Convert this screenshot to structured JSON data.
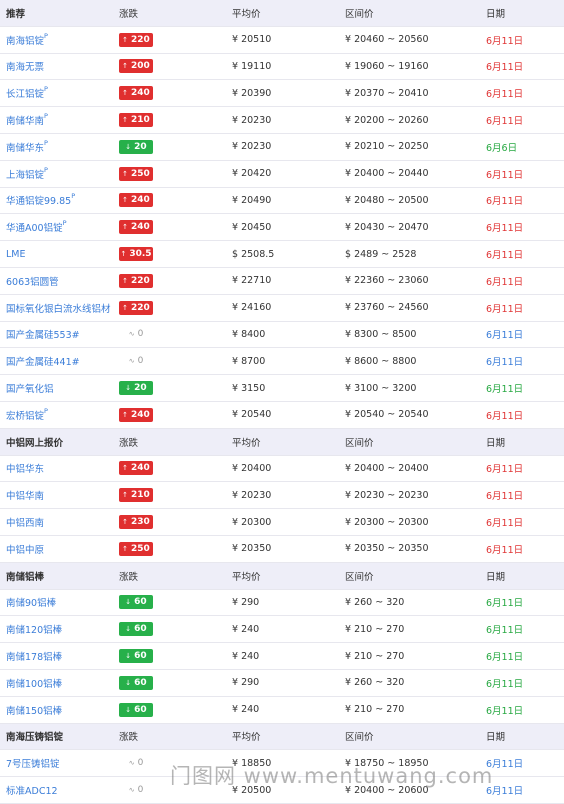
{
  "sections": [
    {
      "header": {
        "name": "推荐",
        "change": "涨跌",
        "avg": "平均价",
        "range": "区间价",
        "date": "日期"
      },
      "rows": [
        {
          "name": "南海铝锭",
          "sup": "P",
          "dir": "up",
          "change": "220",
          "avg": "¥ 20510",
          "range": "¥ 20460 ~ 20560",
          "date": "6月11日",
          "dateColor": "red"
        },
        {
          "name": "南海无票",
          "sup": "",
          "dir": "up",
          "change": "200",
          "avg": "¥ 19110",
          "range": "¥ 19060 ~ 19160",
          "date": "6月11日",
          "dateColor": "red"
        },
        {
          "name": "长江铝锭",
          "sup": "P",
          "dir": "up",
          "change": "240",
          "avg": "¥ 20390",
          "range": "¥ 20370 ~ 20410",
          "date": "6月11日",
          "dateColor": "red"
        },
        {
          "name": "南储华南",
          "sup": "P",
          "dir": "up",
          "change": "210",
          "avg": "¥ 20230",
          "range": "¥ 20200 ~ 20260",
          "date": "6月11日",
          "dateColor": "red"
        },
        {
          "name": "南储华东",
          "sup": "P",
          "dir": "down",
          "change": "20",
          "avg": "¥ 20230",
          "range": "¥ 20210 ~ 20250",
          "date": "6月6日",
          "dateColor": "green"
        },
        {
          "name": "上海铝锭",
          "sup": "P",
          "dir": "up",
          "change": "250",
          "avg": "¥ 20420",
          "range": "¥ 20400 ~ 20440",
          "date": "6月11日",
          "dateColor": "red"
        },
        {
          "name": "华通铝锭99.85",
          "sup": "P",
          "dir": "up",
          "change": "240",
          "avg": "¥ 20490",
          "range": "¥ 20480 ~ 20500",
          "date": "6月11日",
          "dateColor": "red"
        },
        {
          "name": "华通A00铝锭",
          "sup": "P",
          "dir": "up",
          "change": "240",
          "avg": "¥ 20450",
          "range": "¥ 20430 ~ 20470",
          "date": "6月11日",
          "dateColor": "red"
        },
        {
          "name": "LME",
          "sup": "",
          "dir": "up",
          "change": "30.5",
          "avg": "$ 2508.5",
          "range": "$ 2489 ~ 2528",
          "date": "6月11日",
          "dateColor": "red"
        },
        {
          "name": "6063铝圆管",
          "sup": "",
          "dir": "up",
          "change": "220",
          "avg": "¥ 22710",
          "range": "¥ 22360 ~ 23060",
          "date": "6月11日",
          "dateColor": "red"
        },
        {
          "name": "国标氧化银白流水线铝材",
          "sup": "",
          "dir": "up",
          "change": "220",
          "avg": "¥ 24160",
          "range": "¥ 23760 ~ 24560",
          "date": "6月11日",
          "dateColor": "red"
        },
        {
          "name": "国产金属硅553#",
          "sup": "",
          "dir": "flat",
          "change": "0",
          "avg": "¥ 8400",
          "range": "¥ 8300 ~ 8500",
          "date": "6月11日",
          "dateColor": "blue"
        },
        {
          "name": "国产金属硅441#",
          "sup": "",
          "dir": "flat",
          "change": "0",
          "avg": "¥ 8700",
          "range": "¥ 8600 ~ 8800",
          "date": "6月11日",
          "dateColor": "blue"
        },
        {
          "name": "国产氧化铝",
          "sup": "",
          "dir": "down",
          "change": "20",
          "avg": "¥ 3150",
          "range": "¥ 3100 ~ 3200",
          "date": "6月11日",
          "dateColor": "green"
        },
        {
          "name": "宏桥铝锭",
          "sup": "P",
          "dir": "up",
          "change": "240",
          "avg": "¥ 20540",
          "range": "¥ 20540 ~ 20540",
          "date": "6月11日",
          "dateColor": "red"
        }
      ]
    },
    {
      "header": {
        "name": "中铝网上报价",
        "change": "涨跌",
        "avg": "平均价",
        "range": "区间价",
        "date": "日期"
      },
      "rows": [
        {
          "name": "中铝华东",
          "sup": "",
          "dir": "up",
          "change": "240",
          "avg": "¥ 20400",
          "range": "¥ 20400 ~ 20400",
          "date": "6月11日",
          "dateColor": "red"
        },
        {
          "name": "中铝华南",
          "sup": "",
          "dir": "up",
          "change": "210",
          "avg": "¥ 20230",
          "range": "¥ 20230 ~ 20230",
          "date": "6月11日",
          "dateColor": "red"
        },
        {
          "name": "中铝西南",
          "sup": "",
          "dir": "up",
          "change": "230",
          "avg": "¥ 20300",
          "range": "¥ 20300 ~ 20300",
          "date": "6月11日",
          "dateColor": "red"
        },
        {
          "name": "中铝中原",
          "sup": "",
          "dir": "up",
          "change": "250",
          "avg": "¥ 20350",
          "range": "¥ 20350 ~ 20350",
          "date": "6月11日",
          "dateColor": "red"
        }
      ]
    },
    {
      "header": {
        "name": "南储铝棒",
        "change": "涨跌",
        "avg": "平均价",
        "range": "区间价",
        "date": "日期"
      },
      "rows": [
        {
          "name": "南储90铝棒",
          "sup": "",
          "dir": "down",
          "change": "60",
          "avg": "¥ 290",
          "range": "¥ 260 ~ 320",
          "date": "6月11日",
          "dateColor": "green"
        },
        {
          "name": "南储120铝棒",
          "sup": "",
          "dir": "down",
          "change": "60",
          "avg": "¥ 240",
          "range": "¥ 210 ~ 270",
          "date": "6月11日",
          "dateColor": "green"
        },
        {
          "name": "南储178铝棒",
          "sup": "",
          "dir": "down",
          "change": "60",
          "avg": "¥ 240",
          "range": "¥ 210 ~ 270",
          "date": "6月11日",
          "dateColor": "green"
        },
        {
          "name": "南储100铝棒",
          "sup": "",
          "dir": "down",
          "change": "60",
          "avg": "¥ 290",
          "range": "¥ 260 ~ 320",
          "date": "6月11日",
          "dateColor": "green"
        },
        {
          "name": "南储150铝棒",
          "sup": "",
          "dir": "down",
          "change": "60",
          "avg": "¥ 240",
          "range": "¥ 210 ~ 270",
          "date": "6月11日",
          "dateColor": "green"
        }
      ]
    },
    {
      "header": {
        "name": "南海压铸铝锭",
        "change": "涨跌",
        "avg": "平均价",
        "range": "区间价",
        "date": "日期"
      },
      "rows": [
        {
          "name": "7号压铸铝锭",
          "sup": "",
          "dir": "flat",
          "change": "0",
          "avg": "¥ 18850",
          "range": "¥ 18750 ~ 18950",
          "date": "6月11日",
          "dateColor": "blue"
        },
        {
          "name": "标准ADC12",
          "sup": "",
          "dir": "flat",
          "change": "0",
          "avg": "¥ 20500",
          "range": "¥ 20400 ~ 20600",
          "date": "6月11日",
          "dateColor": "blue"
        }
      ]
    }
  ],
  "icons": {
    "up": "arrow-up-icon",
    "down": "arrow-down-icon",
    "flat": "flat-tilde-icon"
  },
  "colors": {
    "up": "#e02f2f",
    "down": "#27b04a",
    "link": "#3b7dd8",
    "header_bg": "#eeeef8"
  },
  "watermark": "门图网 www.mentuwang.com"
}
